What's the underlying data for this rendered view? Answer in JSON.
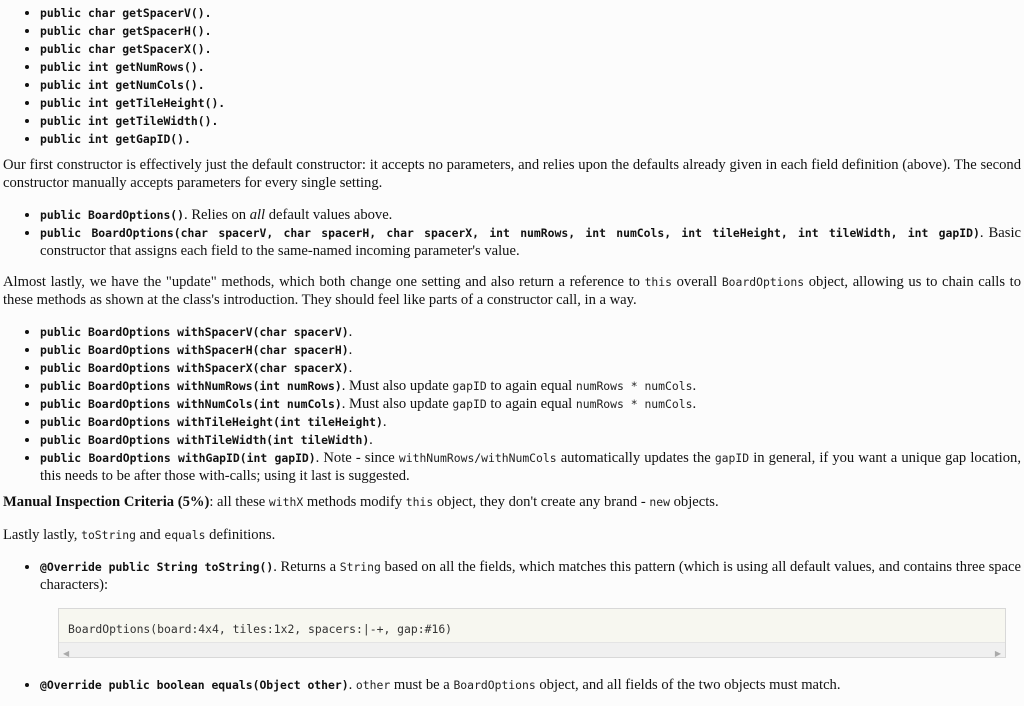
{
  "getters": [
    "public char getSpacerV().",
    "public char getSpacerH().",
    "public char getSpacerX().",
    "public int getNumRows().",
    "public int getNumCols().",
    "public int getTileHeight().",
    "public int getTileWidth().",
    "public int getGapID()."
  ],
  "constructors_intro": "Our first constructor is effectively just the default constructor: it accepts no parameters, and relies upon the defaults already given in each field definition (above). The second constructor manually accepts parameters for every single setting.",
  "constructors": {
    "c1_code": "public BoardOptions()",
    "c1_pre": ". Relies on ",
    "c1_em": "all",
    "c1_post": " default values above.",
    "c2_code": "public BoardOptions(char spacerV, char spacerH, char spacerX, int numRows, int numCols, int tileHeight, int tileWidth, int gapID)",
    "c2_text": ". Basic constructor that assigns each field to the same-named incoming parameter's value."
  },
  "update_intro": {
    "t1": "Almost lastly, we have the \"update\" methods, which both change one setting and also return a reference to ",
    "c1": "this",
    "t2": " overall ",
    "c2": "BoardOptions",
    "t3": " object, allowing us to chain calls to these methods as shown at the class's introduction. They should feel like parts of a constructor call, in a way."
  },
  "withs": {
    "w1": "public BoardOptions withSpacerV(char spacerV)",
    "w2": "public BoardOptions withSpacerH(char spacerH)",
    "w3": "public BoardOptions withSpacerX(char spacerX)",
    "w4": "public BoardOptions withNumRows(int numRows)",
    "w5": "public BoardOptions withNumCols(int numCols)",
    "w6": "public BoardOptions withTileHeight(int tileHeight)",
    "w7": "public BoardOptions withTileWidth(int tileWidth)",
    "w8": "public BoardOptions withGapID(int gapID)",
    "dot": ".",
    "must_update": ". Must also update ",
    "gapID": "gapID",
    "to_again_equal": " to again equal ",
    "numRows_times_numCols": "numRows * numCols",
    "note_pre": ". Note - since ",
    "note_code": "withNumRows/withNumCols",
    "note_mid": " automatically updates the ",
    "note_post": " in general, if you want a unique gap location, this needs to be after those with-calls; using it last is suggested."
  },
  "manual": {
    "bold": "Manual Inspection Criteria (5%)",
    "t1": ": all these ",
    "c1": "withX",
    "t2": " methods modify ",
    "c2": "this",
    "t3": " object, they don't create any brand - ",
    "c3": "new",
    "t4": " objects."
  },
  "lastly": {
    "t1": "Lastly lastly, ",
    "c1": "toString",
    "t2": " and ",
    "c2": "equals",
    "t3": " definitions."
  },
  "tostring": {
    "code": "@Override public String toString()",
    "t1": ". Returns a ",
    "c1": "String",
    "t2": " based on all the fields, which matches this pattern (which is using all default values, and contains three space characters):"
  },
  "example": "BoardOptions(board:4x4, tiles:1x2, spacers:|-+, gap:#16)",
  "equals": {
    "code": "@Override public boolean equals(Object other)",
    "t1": ". ",
    "c1": "other",
    "t2": " must be a ",
    "c2": "BoardOptions",
    "t3": " object, and all fields of the two objects must match."
  }
}
